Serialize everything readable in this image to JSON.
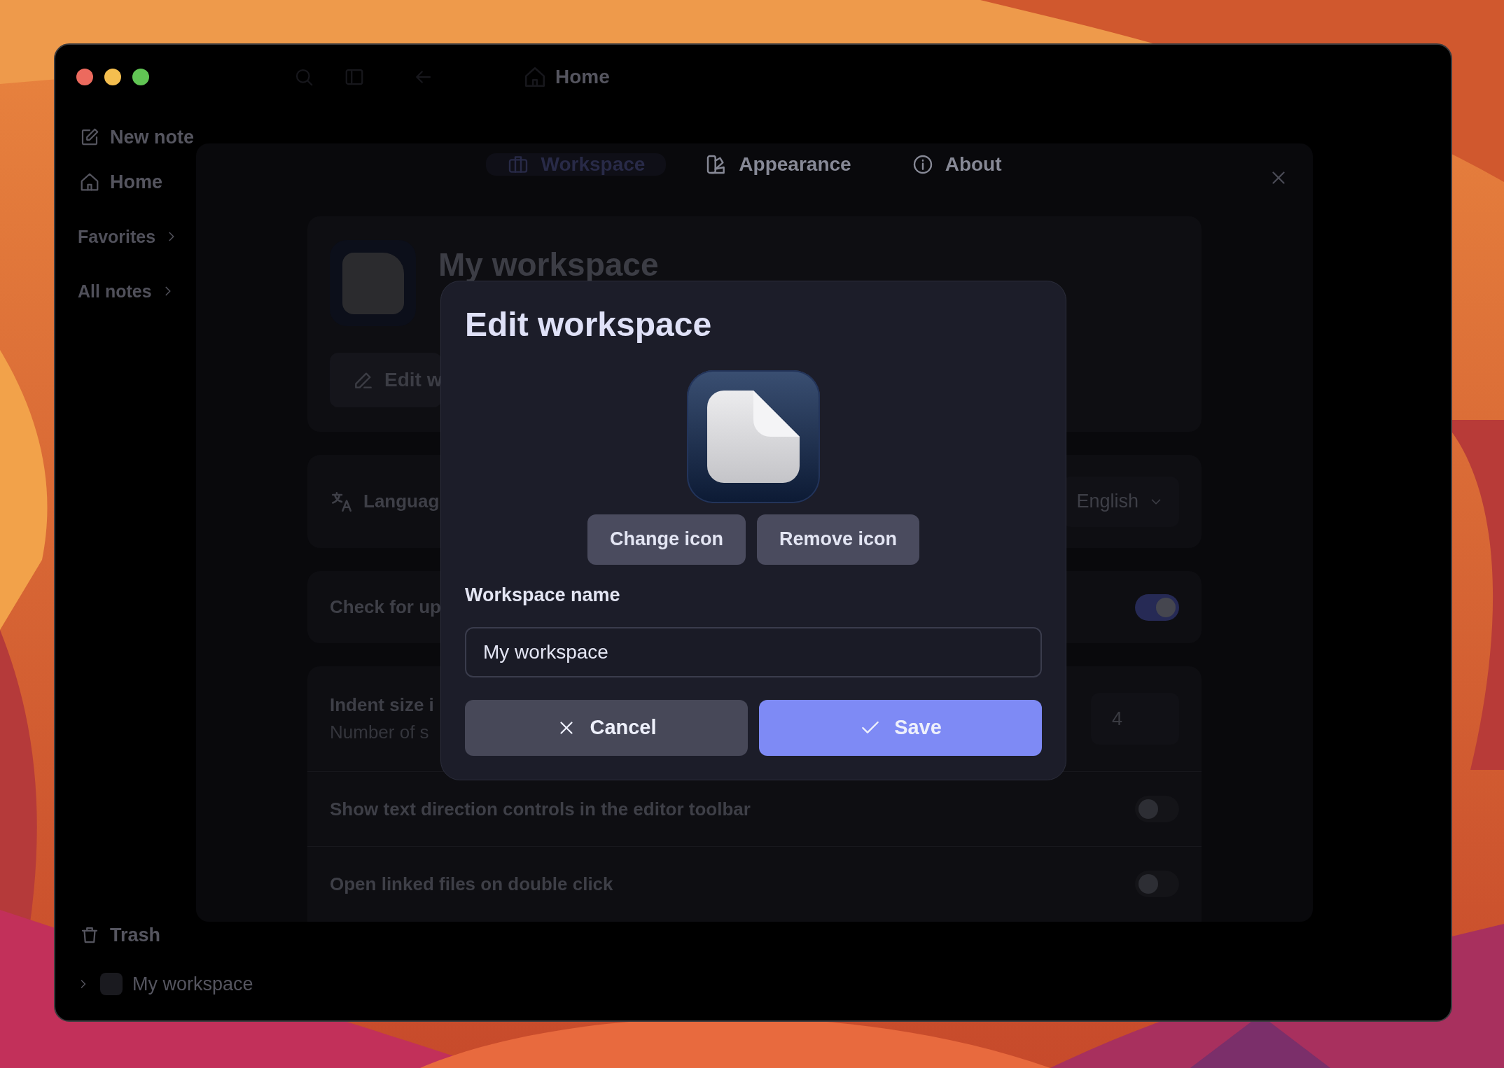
{
  "toolbar": {
    "breadcrumb": "Home"
  },
  "sidebar": {
    "new_note": "New note",
    "home": "Home",
    "sections": [
      "Favorites",
      "All notes"
    ],
    "trash": "Trash",
    "workspace": "My workspace"
  },
  "settings": {
    "tabs": [
      {
        "label": "Workspace",
        "selected": true
      },
      {
        "label": "Appearance",
        "selected": false
      },
      {
        "label": "About",
        "selected": false
      }
    ],
    "workspace_name": "My workspace",
    "edit_button": "Edit w",
    "language": {
      "label": "Languag",
      "value": "English"
    },
    "updates": {
      "label": "Check for up",
      "on": true
    },
    "indent": {
      "label": "Indent size i",
      "description": "Number of s",
      "value": "4"
    },
    "toggles": [
      {
        "label": "Show text direction controls in the editor toolbar",
        "on": false
      },
      {
        "label": "Open linked files on double click",
        "on": false
      }
    ]
  },
  "dialog": {
    "title": "Edit workspace",
    "icon_buttons": [
      "Change icon",
      "Remove icon"
    ],
    "name_label": "Workspace name",
    "name_value": "My workspace",
    "cancel": "Cancel",
    "save": "Save"
  }
}
